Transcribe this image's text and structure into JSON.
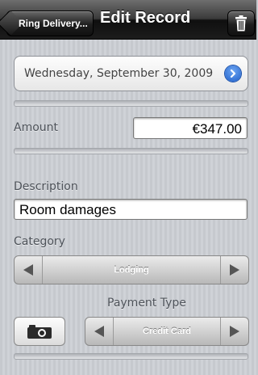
{
  "navbar": {
    "back_label": "Ring Delivery...",
    "title": "Edit Record"
  },
  "date": {
    "value": "Wednesday, September 30, 2009"
  },
  "amount": {
    "label": "Amount",
    "value": "€347.00"
  },
  "description": {
    "label": "Description",
    "value": "Room damages"
  },
  "category": {
    "label": "Category",
    "value": "Lodging"
  },
  "payment": {
    "label": "Payment Type",
    "value": "Credit Card"
  },
  "icons": {
    "trash": "trash-icon",
    "disclosure": "chevron-right-icon",
    "camera": "camera-icon"
  },
  "colors": {
    "disclosure_blue": "#2a6cd6",
    "navbar": "#1c1c1c"
  }
}
